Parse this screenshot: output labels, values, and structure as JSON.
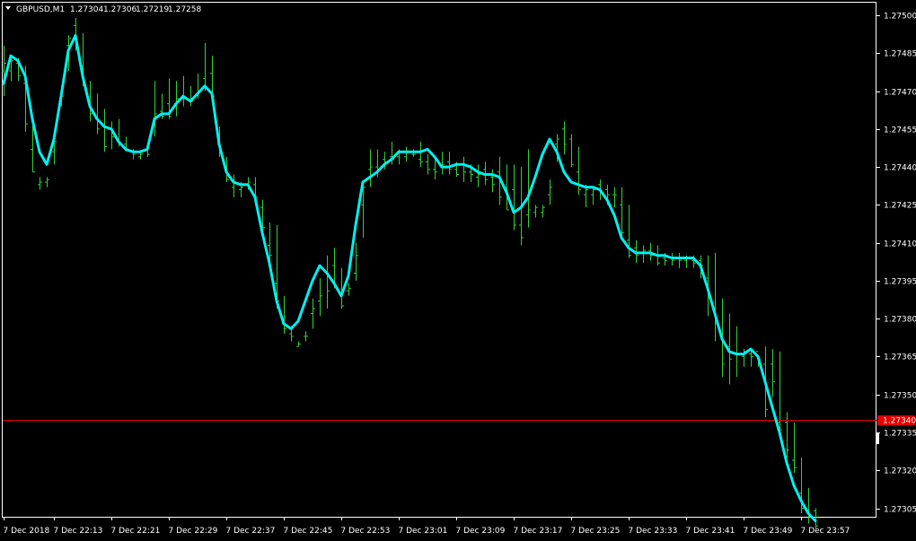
{
  "header": {
    "symbol": "GBPUSD,M1",
    "open": "1.27304",
    "high": "1.27306",
    "low": "1.27219",
    "close": "1.27258"
  },
  "colors": {
    "background": "#000000",
    "bar": "#2fd32f",
    "ma_line": "#00f0f0",
    "current_price_line": "#e00000",
    "axis": "#ffffff"
  },
  "price_axis": {
    "labels": [
      "1.27500",
      "1.27485",
      "1.27470",
      "1.27455",
      "1.27440",
      "1.27425",
      "1.27410",
      "1.27395",
      "1.27380",
      "1.27365",
      "1.27350",
      "1.27335",
      "1.27320",
      "1.27305"
    ],
    "current_price_tag": "1.27340"
  },
  "time_axis": {
    "labels": [
      "7 Dec 2018",
      "7 Dec 22:13",
      "7 Dec 22:21",
      "7 Dec 22:29",
      "7 Dec 22:37",
      "7 Dec 22:45",
      "7 Dec 22:53",
      "7 Dec 23:01",
      "7 Dec 23:09",
      "7 Dec 23:17",
      "7 Dec 23:25",
      "7 Dec 23:33",
      "7 Dec 23:41",
      "7 Dec 23:49",
      "7 Dec 23:57"
    ]
  },
  "chart_data": {
    "type": "line",
    "title": "GBPUSD,M1",
    "ylim": [
      1.27297,
      1.27505
    ],
    "grid": false,
    "current_price": 1.2734,
    "series": [
      {
        "kind": "bars",
        "x": [
          "22:06",
          "22:07",
          "22:08",
          "22:09",
          "22:10",
          "22:11",
          "22:12",
          "22:13",
          "22:14",
          "22:15",
          "22:16",
          "22:17",
          "22:18",
          "22:19",
          "22:20",
          "22:21",
          "22:22",
          "22:23",
          "22:24",
          "22:25",
          "22:26",
          "22:27",
          "22:28",
          "22:29",
          "22:30",
          "22:31",
          "22:32",
          "22:33",
          "22:34",
          "22:35",
          "22:36",
          "22:37",
          "22:38",
          "22:39",
          "22:40",
          "22:41",
          "22:42",
          "22:43",
          "22:44",
          "22:45",
          "22:46",
          "22:47",
          "22:48",
          "22:49",
          "22:50",
          "22:51",
          "22:52",
          "22:53",
          "22:54",
          "22:55",
          "22:56",
          "22:57",
          "22:58",
          "22:59",
          "23:00",
          "23:01",
          "23:02",
          "23:03",
          "23:04",
          "23:05",
          "23:06",
          "23:07",
          "23:08",
          "23:09",
          "23:10",
          "23:11",
          "23:12",
          "23:13",
          "23:14",
          "23:15",
          "23:16",
          "23:17",
          "23:18",
          "23:19",
          "23:20",
          "23:21",
          "23:22",
          "23:23",
          "23:24",
          "23:25",
          "23:26",
          "23:27",
          "23:28",
          "23:29",
          "23:30",
          "23:31",
          "23:32",
          "23:33",
          "23:34",
          "23:35",
          "23:36",
          "23:37",
          "23:38",
          "23:39",
          "23:40",
          "23:41",
          "23:42",
          "23:43",
          "23:44",
          "23:45",
          "23:46",
          "23:47",
          "23:48",
          "23:49",
          "23:50",
          "23:51",
          "23:52",
          "23:53",
          "23:54",
          "23:55",
          "23:56",
          "23:57",
          "23:58",
          "23:59"
        ],
        "high": [
          1.27488,
          1.27484,
          1.27483,
          1.2748,
          1.27459,
          1.27436,
          1.27436,
          1.27452,
          1.27472,
          1.27492,
          1.27499,
          1.27493,
          1.27474,
          1.27469,
          1.27463,
          1.27458,
          1.27459,
          1.27452,
          1.27447,
          1.27446,
          1.27449,
          1.27474,
          1.27469,
          1.27475,
          1.27474,
          1.27476,
          1.27472,
          1.27477,
          1.27489,
          1.27484,
          1.27456,
          1.27444,
          1.27437,
          1.27434,
          1.27436,
          1.27436,
          1.27427,
          1.27418,
          1.27417,
          1.27389,
          1.27377,
          1.27371,
          1.27375,
          1.27388,
          1.27396,
          1.27405,
          1.27408,
          1.274,
          1.27394,
          1.2741,
          1.27434,
          1.27447,
          1.27447,
          1.27446,
          1.2745,
          1.27447,
          1.27448,
          1.27447,
          1.2745,
          1.27445,
          1.27444,
          1.27446,
          1.27446,
          1.27442,
          1.27444,
          1.27441,
          1.27441,
          1.27442,
          1.27439,
          1.27444,
          1.27441,
          1.27441,
          1.2744,
          1.27447,
          1.27425,
          1.27425,
          1.27435,
          1.27453,
          1.27458,
          1.27453,
          1.27448,
          1.27433,
          1.27432,
          1.27435,
          1.27433,
          1.27432,
          1.27432,
          1.27425,
          1.27411,
          1.27409,
          1.2741,
          1.27409,
          1.27406,
          1.27406,
          1.27406,
          1.27405,
          1.27405,
          1.27405,
          1.27405,
          1.27406,
          1.27388,
          1.27382,
          1.27377,
          1.27368,
          1.27368,
          1.27364,
          1.27369,
          1.27368,
          1.27367,
          1.27343,
          1.27339,
          1.27325,
          1.27313,
          1.27305
        ],
        "low": [
          1.27468,
          1.27474,
          1.27474,
          1.27454,
          1.27438,
          1.27431,
          1.27432,
          1.27441,
          1.27464,
          1.27478,
          1.27486,
          1.27472,
          1.27458,
          1.27453,
          1.27446,
          1.27447,
          1.27448,
          1.27446,
          1.27443,
          1.27443,
          1.27444,
          1.27452,
          1.27459,
          1.27459,
          1.2746,
          1.27464,
          1.27464,
          1.27467,
          1.2747,
          1.27466,
          1.27444,
          1.27434,
          1.27428,
          1.27428,
          1.27431,
          1.27425,
          1.27415,
          1.27402,
          1.27384,
          1.27374,
          1.27371,
          1.27369,
          1.27371,
          1.27376,
          1.27381,
          1.27384,
          1.27392,
          1.27384,
          1.27389,
          1.27395,
          1.27412,
          1.27432,
          1.27436,
          1.27439,
          1.27441,
          1.27441,
          1.27442,
          1.27444,
          1.2744,
          1.27437,
          1.27435,
          1.27437,
          1.27437,
          1.27436,
          1.27434,
          1.27434,
          1.27432,
          1.27433,
          1.2743,
          1.27425,
          1.27423,
          1.27415,
          1.27409,
          1.27416,
          1.2742,
          1.2742,
          1.27425,
          1.27442,
          1.27445,
          1.2744,
          1.27429,
          1.27424,
          1.27425,
          1.27427,
          1.27425,
          1.27424,
          1.27412,
          1.27404,
          1.27402,
          1.27402,
          1.27403,
          1.27401,
          1.27401,
          1.27401,
          1.274,
          1.274,
          1.274,
          1.27396,
          1.27381,
          1.27371,
          1.27357,
          1.27354,
          1.27357,
          1.27361,
          1.27361,
          1.27361,
          1.27341,
          1.27349,
          1.27335,
          1.27325,
          1.27319,
          1.27303,
          1.27299,
          1.27297
        ],
        "open": [
          1.27478,
          1.27478,
          1.27481,
          1.27473,
          1.27447,
          1.27433,
          1.27434,
          1.27446,
          1.27467,
          1.27488,
          1.27496,
          1.2748,
          1.27466,
          1.27459,
          1.27456,
          1.27455,
          1.27451,
          1.27449,
          1.27446,
          1.27444,
          1.27447,
          1.27458,
          1.27462,
          1.27465,
          1.27465,
          1.27467,
          1.27466,
          1.27469,
          1.27475,
          1.27477,
          1.27449,
          1.27439,
          1.27432,
          1.27431,
          1.27433,
          1.27433,
          1.27424,
          1.27409,
          1.27394,
          1.27378,
          1.27374,
          1.27369,
          1.27373,
          1.27382,
          1.27387,
          1.27398,
          1.27401,
          1.27389,
          1.27391,
          1.27398,
          1.27425,
          1.27439,
          1.2744,
          1.27443,
          1.27444,
          1.27444,
          1.27444,
          1.27445,
          1.27443,
          1.27442,
          1.27439,
          1.2744,
          1.27442,
          1.27439,
          1.27441,
          1.27438,
          1.27436,
          1.27439,
          1.27436,
          1.27438,
          1.27432,
          1.27431,
          1.27417,
          1.27421,
          1.27422,
          1.27422,
          1.27429,
          1.27449,
          1.27455,
          1.27451,
          1.27438,
          1.27429,
          1.27429,
          1.27433,
          1.27431,
          1.27429,
          1.27425,
          1.27411,
          1.27408,
          1.27406,
          1.27407,
          1.27405,
          1.27404,
          1.27404,
          1.27404,
          1.27403,
          1.27403,
          1.27403,
          1.27396,
          1.27384,
          1.27373,
          1.27369,
          1.27366,
          1.27365,
          1.27366,
          1.27367,
          1.27362,
          1.27362,
          1.27339,
          1.27339,
          1.27324,
          1.27311,
          1.27304,
          1.27304
        ],
        "close": [
          1.27481,
          1.27482,
          1.27476,
          1.27457,
          1.27438,
          1.27434,
          1.27435,
          1.2745,
          1.27468,
          1.27491,
          1.27488,
          1.27474,
          1.27461,
          1.27455,
          1.27448,
          1.27452,
          1.27449,
          1.27447,
          1.27445,
          1.27445,
          1.27445,
          1.27461,
          1.2746,
          1.2746,
          1.27467,
          1.27467,
          1.27466,
          1.2747,
          1.27471,
          1.27468,
          1.27446,
          1.27435,
          1.27434,
          1.27432,
          1.27434,
          1.27428,
          1.27416,
          1.27405,
          1.27387,
          1.27376,
          1.27373,
          1.2737,
          1.27373,
          1.27384,
          1.27389,
          1.27391,
          1.27393,
          1.27385,
          1.27392,
          1.27405,
          1.27432,
          1.2744,
          1.27439,
          1.27442,
          1.27443,
          1.27446,
          1.27446,
          1.27445,
          1.27442,
          1.27439,
          1.27438,
          1.27441,
          1.27439,
          1.27437,
          1.27438,
          1.27437,
          1.27437,
          1.27435,
          1.27433,
          1.27428,
          1.27423,
          1.27417,
          1.27412,
          1.27423,
          1.27424,
          1.27424,
          1.27432,
          1.27451,
          1.27449,
          1.27441,
          1.27431,
          1.27431,
          1.27431,
          1.2743,
          1.27429,
          1.27429,
          1.27414,
          1.27405,
          1.27405,
          1.27407,
          1.27405,
          1.27402,
          1.27403,
          1.27403,
          1.27403,
          1.27404,
          1.27402,
          1.27401,
          1.27388,
          1.27378,
          1.27362,
          1.27364,
          1.27366,
          1.27367,
          1.27365,
          1.27364,
          1.27344,
          1.27355,
          1.27336,
          1.27328,
          1.27321,
          1.27305,
          1.27302,
          1.27298
        ]
      },
      {
        "kind": "moving-average",
        "x": [
          "22:06",
          "22:07",
          "22:08",
          "22:09",
          "22:10",
          "22:11",
          "22:12",
          "22:13",
          "22:14",
          "22:15",
          "22:16",
          "22:17",
          "22:18",
          "22:19",
          "22:20",
          "22:21",
          "22:22",
          "22:23",
          "22:24",
          "22:25",
          "22:26",
          "22:27",
          "22:28",
          "22:29",
          "22:30",
          "22:31",
          "22:32",
          "22:33",
          "22:34",
          "22:35",
          "22:36",
          "22:37",
          "22:38",
          "22:39",
          "22:40",
          "22:41",
          "22:42",
          "22:43",
          "22:44",
          "22:45",
          "22:46",
          "22:47",
          "22:48",
          "22:49",
          "22:50",
          "22:51",
          "22:52",
          "22:53",
          "22:54",
          "22:55",
          "22:56",
          "22:57",
          "22:58",
          "22:59",
          "23:00",
          "23:01",
          "23:02",
          "23:03",
          "23:04",
          "23:05",
          "23:06",
          "23:07",
          "23:08",
          "23:09",
          "23:10",
          "23:11",
          "23:12",
          "23:13",
          "23:14",
          "23:15",
          "23:16",
          "23:17",
          "23:18",
          "23:19",
          "23:20",
          "23:21",
          "23:22",
          "23:23",
          "23:24",
          "23:25",
          "23:26",
          "23:27",
          "23:28",
          "23:29",
          "23:30",
          "23:31",
          "23:32",
          "23:33",
          "23:34",
          "23:35",
          "23:36",
          "23:37",
          "23:38",
          "23:39",
          "23:40",
          "23:41",
          "23:42",
          "23:43",
          "23:44",
          "23:45",
          "23:46",
          "23:47",
          "23:48",
          "23:49",
          "23:50",
          "23:51",
          "23:52",
          "23:53",
          "23:54",
          "23:55",
          "23:56",
          "23:57",
          "23:58",
          "23:59"
        ],
        "values": [
          1.27473,
          1.27484,
          1.27482,
          1.27476,
          1.27459,
          1.27446,
          1.27441,
          1.27451,
          1.27468,
          1.27486,
          1.27492,
          1.27476,
          1.27464,
          1.27459,
          1.27456,
          1.27455,
          1.2745,
          1.27447,
          1.27446,
          1.27446,
          1.27447,
          1.27459,
          1.27461,
          1.27461,
          1.27465,
          1.27468,
          1.27466,
          1.27469,
          1.27472,
          1.27469,
          1.27449,
          1.27438,
          1.27434,
          1.27433,
          1.27433,
          1.27428,
          1.27414,
          1.27402,
          1.27387,
          1.27378,
          1.27376,
          1.27379,
          1.27387,
          1.27395,
          1.27401,
          1.27398,
          1.27394,
          1.27389,
          1.27397,
          1.27417,
          1.27434,
          1.27436,
          1.27438,
          1.27441,
          1.27443,
          1.27446,
          1.27446,
          1.27446,
          1.27446,
          1.27447,
          1.27444,
          1.2744,
          1.2744,
          1.27441,
          1.27441,
          1.2744,
          1.27438,
          1.27437,
          1.27437,
          1.27436,
          1.2743,
          1.27422,
          1.27424,
          1.27428,
          1.27436,
          1.27445,
          1.27451,
          1.27446,
          1.27438,
          1.27434,
          1.27433,
          1.27432,
          1.27432,
          1.27431,
          1.27427,
          1.27421,
          1.27412,
          1.27408,
          1.27406,
          1.27406,
          1.27406,
          1.27405,
          1.27405,
          1.27404,
          1.27404,
          1.27404,
          1.27404,
          1.27401,
          1.27392,
          1.27382,
          1.27372,
          1.27367,
          1.27366,
          1.27366,
          1.27368,
          1.27365,
          1.27355,
          1.27345,
          1.27335,
          1.27323,
          1.27314,
          1.27308,
          1.27303,
          1.273
        ]
      }
    ]
  }
}
